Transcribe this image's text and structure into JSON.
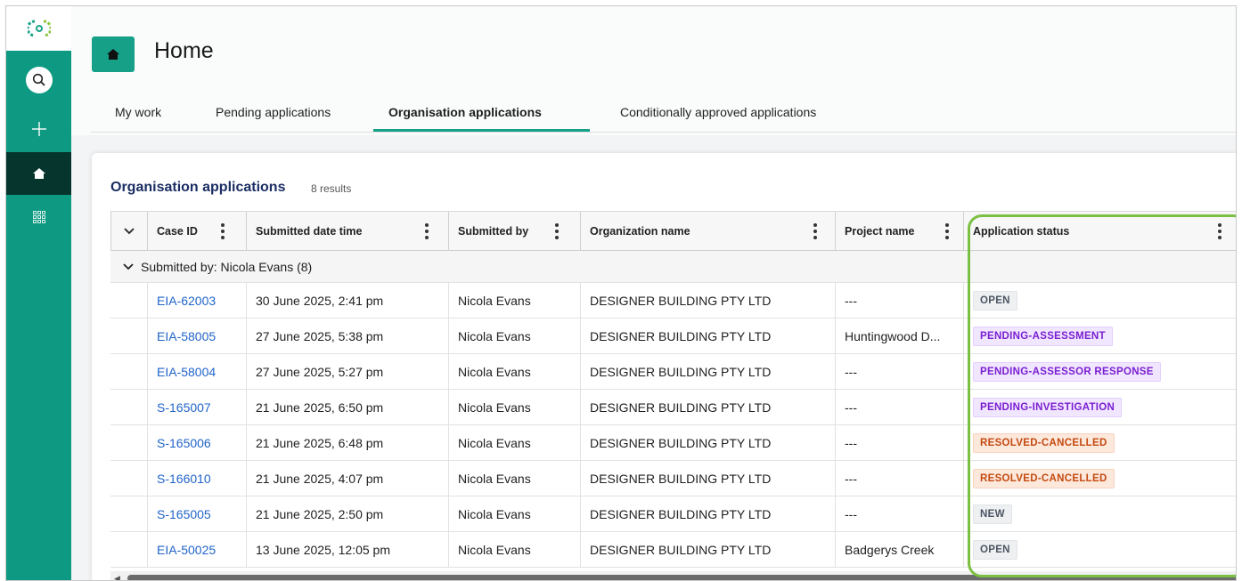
{
  "header": {
    "title": "Home",
    "tabs": [
      {
        "label": "My work"
      },
      {
        "label": "Pending applications"
      },
      {
        "label": "Organisation applications"
      },
      {
        "label": "Conditionally approved applications"
      }
    ]
  },
  "sidebar": {
    "items": [
      {
        "icon": "search-icon"
      },
      {
        "icon": "plus-icon"
      },
      {
        "icon": "home-icon"
      },
      {
        "icon": "apps-grid-icon"
      }
    ]
  },
  "card": {
    "title": "Organisation applications",
    "count": "8 results"
  },
  "table": {
    "columns": [
      "Case ID",
      "Submitted date time",
      "Submitted by",
      "Organization name",
      "Project name",
      "Application status"
    ],
    "group_label": "Submitted by: Nicola Evans (8)",
    "rows": [
      {
        "case_id": "EIA-62003",
        "date": "30 June 2025, 2:41 pm",
        "by": "Nicola Evans",
        "org": "DESIGNER BUILDING PTY LTD",
        "project": "---",
        "status": "OPEN",
        "status_color": "grey"
      },
      {
        "case_id": "EIA-58005",
        "date": "27 June 2025, 5:38 pm",
        "by": "Nicola Evans",
        "org": "DESIGNER BUILDING PTY LTD",
        "project": "Huntingwood D...",
        "status": "PENDING-ASSESSMENT",
        "status_color": "purple"
      },
      {
        "case_id": "EIA-58004",
        "date": "27 June 2025, 5:27 pm",
        "by": "Nicola Evans",
        "org": "DESIGNER BUILDING PTY LTD",
        "project": "---",
        "status": "PENDING-ASSESSOR RESPONSE",
        "status_color": "purple"
      },
      {
        "case_id": "S-165007",
        "date": "21 June 2025, 6:50 pm",
        "by": "Nicola Evans",
        "org": "DESIGNER BUILDING PTY LTD",
        "project": "---",
        "status": "PENDING-INVESTIGATION",
        "status_color": "purple"
      },
      {
        "case_id": "S-165006",
        "date": "21 June 2025, 6:48 pm",
        "by": "Nicola Evans",
        "org": "DESIGNER BUILDING PTY LTD",
        "project": "---",
        "status": "RESOLVED-CANCELLED",
        "status_color": "orange"
      },
      {
        "case_id": "S-166010",
        "date": "21 June 2025, 4:07 pm",
        "by": "Nicola Evans",
        "org": "DESIGNER BUILDING PTY LTD",
        "project": "---",
        "status": "RESOLVED-CANCELLED",
        "status_color": "orange"
      },
      {
        "case_id": "S-165005",
        "date": "21 June 2025, 2:50 pm",
        "by": "Nicola Evans",
        "org": "DESIGNER BUILDING PTY LTD",
        "project": "---",
        "status": "NEW",
        "status_color": "grey"
      },
      {
        "case_id": "EIA-50025",
        "date": "13 June 2025, 12:05 pm",
        "by": "Nicola Evans",
        "org": "DESIGNER BUILDING PTY LTD",
        "project": "Badgerys Creek",
        "status": "OPEN",
        "status_color": "grey"
      }
    ]
  },
  "colors": {
    "brand": "#0e9a82",
    "link": "#2164c9",
    "title": "#1b2e63",
    "highlight": "#7bc043"
  }
}
